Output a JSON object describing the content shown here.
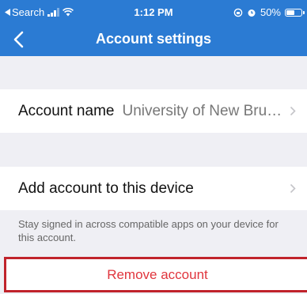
{
  "status_bar": {
    "back_app": "Search",
    "time": "1:12 PM",
    "battery": "50%"
  },
  "nav": {
    "title": "Account settings"
  },
  "account_name": {
    "label": "Account name",
    "value": "University of New Bruns…"
  },
  "add_account": {
    "label": "Add account to this device",
    "description": "Stay signed in across compatible apps on your device for this account."
  },
  "remove": {
    "label": "Remove account"
  },
  "colors": {
    "header": "#2b7bd3",
    "danger": "#e0353d",
    "highlight_border": "#c0232b"
  }
}
